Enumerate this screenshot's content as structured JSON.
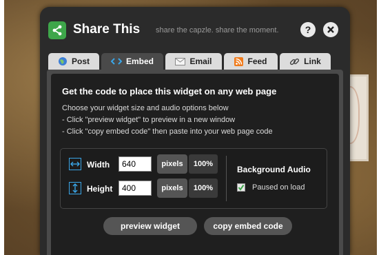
{
  "header": {
    "title": "Share This",
    "tagline": "share the capzle. share the moment.",
    "help_label": "?",
    "close_label": "✖"
  },
  "tabs": [
    {
      "label": "Post",
      "icon": "globe-icon",
      "active": false
    },
    {
      "label": "Embed",
      "icon": "code-icon",
      "active": true
    },
    {
      "label": "Email",
      "icon": "envelope-icon",
      "active": false
    },
    {
      "label": "Feed",
      "icon": "rss-icon",
      "active": false
    },
    {
      "label": "Link",
      "icon": "link-icon",
      "active": false
    }
  ],
  "embed": {
    "heading": "Get the code to place this widget on any web page",
    "desc_line1": "Choose your widget size and audio options below",
    "desc_line2": "- Click \"preview widget\" to preview in a new window",
    "desc_line3": "- Click \"copy embed code\" then paste into your web page code",
    "width": {
      "label": "Width",
      "value": "640",
      "unit": "pixels",
      "percent": "100%"
    },
    "height": {
      "label": "Height",
      "value": "400",
      "unit": "pixels",
      "percent": "100%"
    },
    "audio": {
      "title": "Background Audio",
      "option_label": "Paused on load",
      "checked": true
    },
    "preview_label": "preview widget",
    "copy_label": "copy embed code"
  },
  "colors": {
    "accent_green": "#3ea64a",
    "dialog_bg": "#2b2b2b",
    "feed_orange": "#f07a1a",
    "embed_blue": "#3aa6e8"
  }
}
